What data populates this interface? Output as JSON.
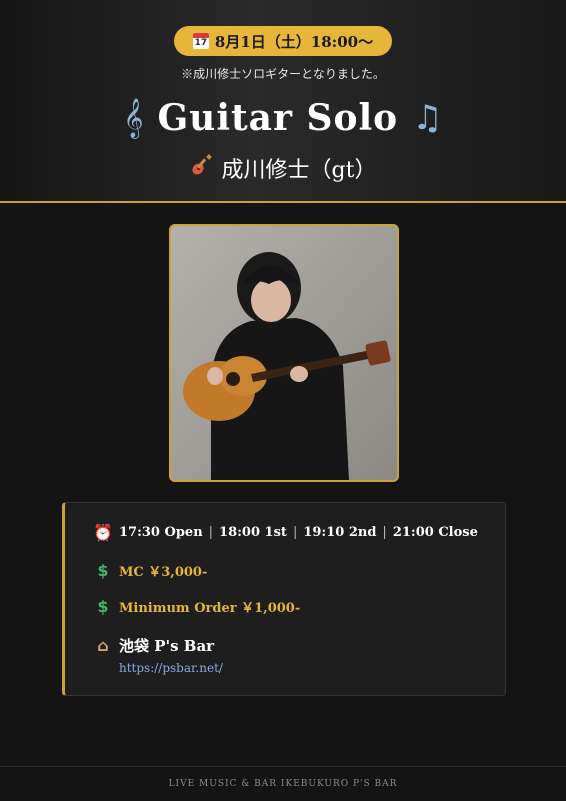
{
  "header": {
    "date": "8月1日（土）18:00～",
    "calendar_icon_number": "17",
    "note": "※成川修士ソロギターとなりました。",
    "title": "Guitar Solo",
    "artist": "成川修士（gt）",
    "icons": {
      "left": "musical-score-icon",
      "right": "musical-notes-icon",
      "artist": "guitar-icon",
      "date": "calendar-icon"
    }
  },
  "info": {
    "schedule": [
      "17:30 Open",
      "18:00 1st",
      "19:10 2nd",
      "21:00 Close"
    ],
    "schedule_separator": "|",
    "mc": "MC ￥3,000-",
    "minimum_order": "Minimum Order ￥1,000-",
    "venue": "池袋 P's Bar",
    "url": "https://psbar.net/"
  },
  "footer": "LIVE MUSIC & BAR IKEBUKURO P'S BAR",
  "colors": {
    "accent": "#e6b63a",
    "border": "#c9a23a",
    "background": "#141414",
    "link": "#8fa8e8"
  }
}
